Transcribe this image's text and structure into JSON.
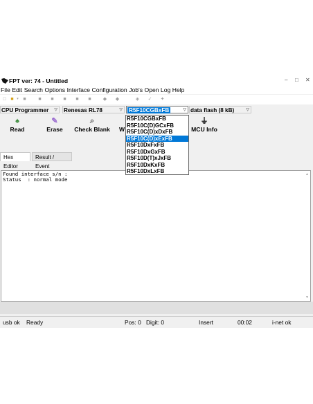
{
  "window": {
    "title": "FPT ver: 74 - Untitled",
    "controls": [
      "–",
      "□",
      "✕"
    ]
  },
  "menu": [
    "File",
    "Edit",
    "Search",
    "Options",
    "Interface",
    "Configuration",
    "Job's",
    "Open Log",
    "Help"
  ],
  "selectors": {
    "programmer": "CPU Programmer",
    "family": "Renesas RL78",
    "device": "R5F10CGBxFB",
    "flash_area": "data flash (8 kB)"
  },
  "actions": {
    "read": "Read",
    "erase": "Erase",
    "check_blank": "Check Blank",
    "write_partial": "W",
    "mcu_info": "MCU Info"
  },
  "tabs": [
    "Hex Editor",
    "Result / Event"
  ],
  "log_lines": [
    "Found interface s/n :",
    "Status  : normal mode"
  ],
  "device_list": [
    "R5F10CGBxFB",
    "R5F10C(D)GCxFB",
    "R5F10C(D)xDxFB",
    "R5F10C(D)xExFB",
    "R5F10DxFxFB",
    "R5F10DxGxFB",
    "R5F10D(T)xJxFB",
    "R5F10DxKxFB",
    "R5F10DxLxFB"
  ],
  "device_list_highlighted": "R5F10C(D)xExFB",
  "status": {
    "usb": "usb ok",
    "state": "Ready",
    "pos": "Pos: 0",
    "digit": "Digit: 0",
    "mode": "Insert",
    "time": "00:02",
    "inet": "i-net ok"
  },
  "colors": {
    "selection": "#0078d7",
    "window_bg": "#f0f0f0"
  }
}
